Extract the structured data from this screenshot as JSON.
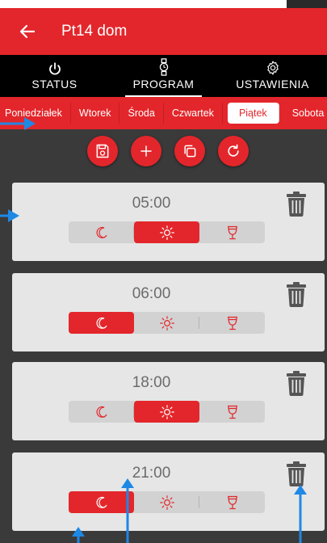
{
  "app": {
    "title": "Pt14 dom"
  },
  "nav": [
    {
      "label": "STATUS",
      "icon": "power-icon",
      "active": false
    },
    {
      "label": "PROGRAM",
      "icon": "clock-program-icon",
      "active": true
    },
    {
      "label": "USTAWIENIA",
      "icon": "gear-icon",
      "active": false
    }
  ],
  "days": [
    "Poniedziałek",
    "Wtorek",
    "Środa",
    "Czwartek",
    "Piątek",
    "Sobota"
  ],
  "active_day": "Piątek",
  "actions": [
    "save-icon",
    "plus-icon",
    "copy-icon",
    "refresh-icon"
  ],
  "entries": [
    {
      "time": "05:00",
      "mode": "day"
    },
    {
      "time": "06:00",
      "mode": "night"
    },
    {
      "time": "18:00",
      "mode": "day"
    },
    {
      "time": "21:00",
      "mode": "night"
    }
  ],
  "modes": [
    "night",
    "day",
    "party"
  ],
  "colors": {
    "accent": "#e3262b",
    "card": "#e6e6e6",
    "background": "#3a3a3a",
    "annotation_arrow": "#1e88e5"
  }
}
